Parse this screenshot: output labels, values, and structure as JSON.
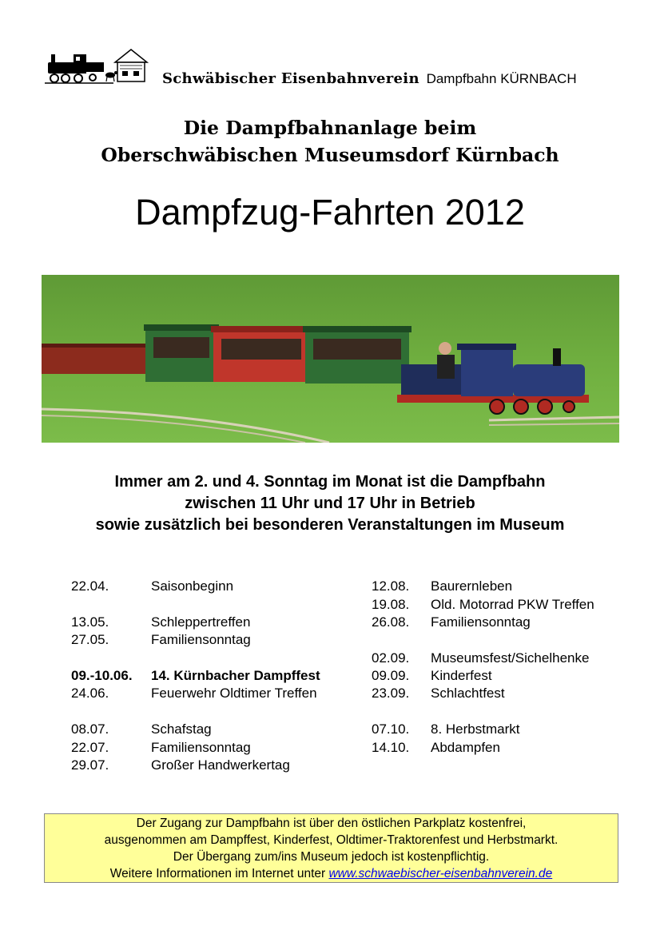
{
  "header": {
    "org_name": "Schwäbischer Eisenbahnverein",
    "org_sub": "Dampfbahn KÜRNBACH"
  },
  "headline": {
    "line1": "Die Dampfbahnanlage beim",
    "line2": "Oberschwäbischen Museumsdorf Kürnbach"
  },
  "title": "Dampfzug-Fahrten 2012",
  "schedule_info": {
    "line1": "Immer am 2. und 4. Sonntag im Monat ist die Dampfbahn",
    "line2": "zwischen 11 Uhr und 17 Uhr in Betrieb",
    "line3": "sowie zusätzlich bei besonderen Veranstaltungen im Museum"
  },
  "events_left": [
    {
      "date": "22.04.",
      "name": "Saisonbeginn"
    },
    {
      "date": "13.05.",
      "name": "Schleppertreffen"
    },
    {
      "date": "27.05.",
      "name": "Familiensonntag"
    },
    {
      "date": "09.-10.06.",
      "name": "14. Kürnbacher Dampffest"
    },
    {
      "date": "24.06.",
      "name": "Feuerwehr Oldtimer Treffen"
    },
    {
      "date": "08.07.",
      "name": "Schafstag"
    },
    {
      "date": "22.07.",
      "name": "Familiensonntag"
    },
    {
      "date": "29.07.",
      "name": "Großer Handwerkertag"
    }
  ],
  "events_right": [
    {
      "date": "12.08.",
      "name": "Baurernleben"
    },
    {
      "date": "19.08.",
      "name": "Old. Motorrad PKW Treffen"
    },
    {
      "date": "26.08.",
      "name": "Familiensonntag"
    },
    {
      "date": "02.09.",
      "name": "Museumsfest/Sichelhenke"
    },
    {
      "date": "09.09.",
      "name": "Kinderfest"
    },
    {
      "date": "23.09.",
      "name": "Schlachtfest"
    },
    {
      "date": "07.10.",
      "name": "8. Herbstmarkt"
    },
    {
      "date": "14.10.",
      "name": "Abdampfen"
    }
  ],
  "notice": {
    "line1": "Der Zugang zur Dampfbahn ist über den östlichen Parkplatz kostenfrei,",
    "line2": "ausgenommen am Dampffest, Kinderfest, Oldtimer-Traktorenfest und Herbstmarkt.",
    "line3": "Der Übergang zum/ins Museum jedoch ist kostenpflichtig.",
    "line4_prefix": "Weitere Informationen im Internet unter",
    "link": "www.schwaebischer-eisenbahnverein.de"
  }
}
